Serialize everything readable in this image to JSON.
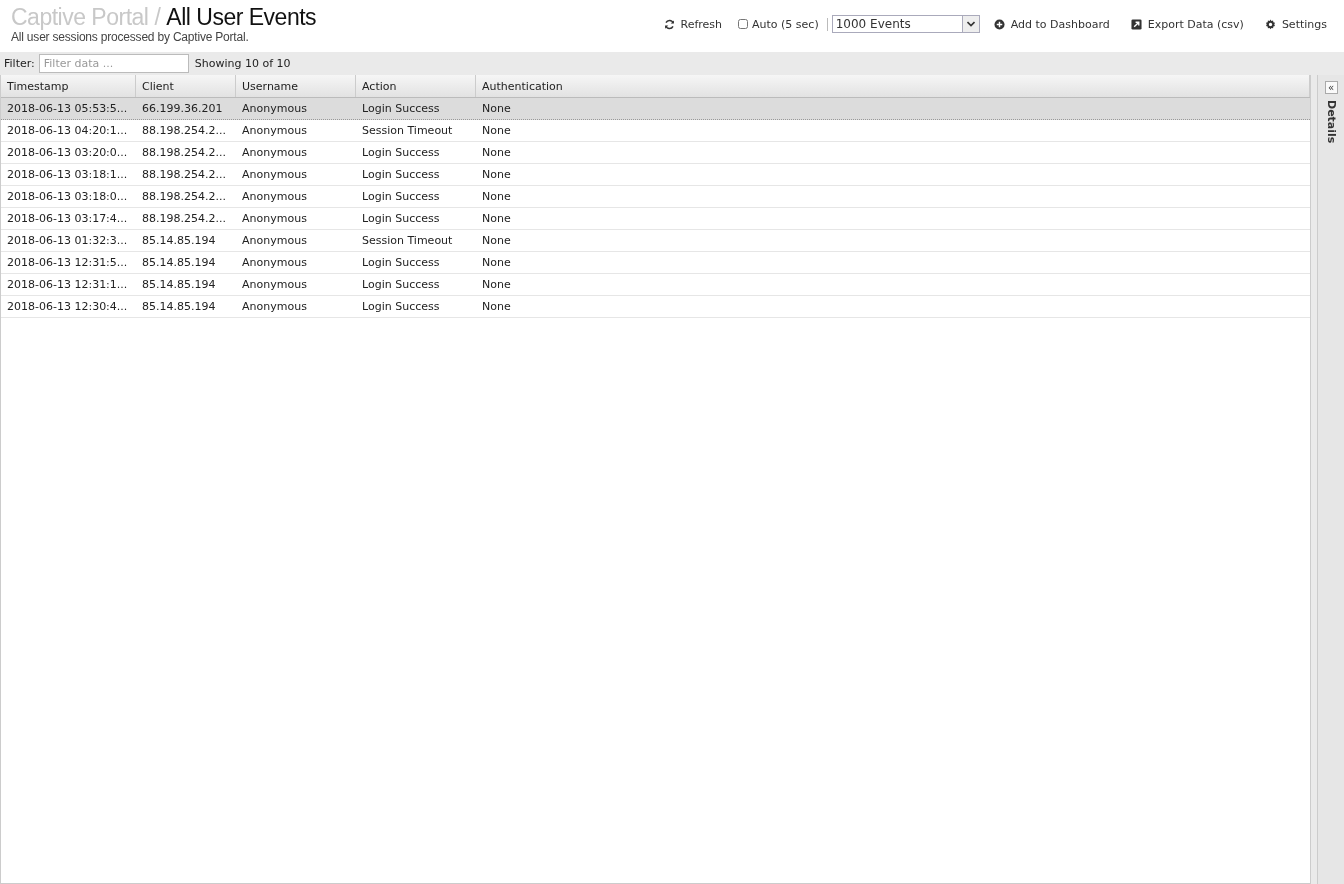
{
  "header": {
    "breadcrumb": "Captive Portal",
    "separator": "/",
    "title": "All User Events",
    "subtitle": "All user sessions processed by Captive Portal."
  },
  "toolbar": [
    {
      "kind": "button",
      "label": "Refresh"
    },
    {
      "kind": "checkbox",
      "label": "Auto (5 sec)",
      "checked": false
    },
    {
      "kind": "select",
      "value": "1000 Events"
    },
    {
      "kind": "button",
      "label": "Add to Dashboard"
    },
    {
      "kind": "button",
      "label": "Export Data (csv)"
    },
    {
      "kind": "button",
      "label": "Settings"
    }
  ],
  "filter": {
    "label": "Filter:",
    "placeholder": "Filter data ...",
    "count": "Showing 10 of 10"
  },
  "table": {
    "columns": [
      "Timestamp",
      "Client",
      "Username",
      "Action",
      "Authentication"
    ],
    "rows": [
      {
        "selected": true,
        "cells": [
          "2018-06-13 05:53:5...",
          "66.199.36.201",
          "Anonymous",
          "Login Success",
          "None"
        ]
      },
      {
        "selected": false,
        "cells": [
          "2018-06-13 04:20:1...",
          "88.198.254.2...",
          "Anonymous",
          "Session Timeout",
          "None"
        ]
      },
      {
        "selected": false,
        "cells": [
          "2018-06-13 03:20:0...",
          "88.198.254.2...",
          "Anonymous",
          "Login Success",
          "None"
        ]
      },
      {
        "selected": false,
        "cells": [
          "2018-06-13 03:18:1...",
          "88.198.254.2...",
          "Anonymous",
          "Login Success",
          "None"
        ]
      },
      {
        "selected": false,
        "cells": [
          "2018-06-13 03:18:0...",
          "88.198.254.2...",
          "Anonymous",
          "Login Success",
          "None"
        ]
      },
      {
        "selected": false,
        "cells": [
          "2018-06-13 03:17:4...",
          "88.198.254.2...",
          "Anonymous",
          "Login Success",
          "None"
        ]
      },
      {
        "selected": false,
        "cells": [
          "2018-06-13 01:32:3...",
          "85.14.85.194",
          "Anonymous",
          "Session Timeout",
          "None"
        ]
      },
      {
        "selected": false,
        "cells": [
          "2018-06-13 12:31:5...",
          "85.14.85.194",
          "Anonymous",
          "Login Success",
          "None"
        ]
      },
      {
        "selected": false,
        "cells": [
          "2018-06-13 12:31:1...",
          "85.14.85.194",
          "Anonymous",
          "Login Success",
          "None"
        ]
      },
      {
        "selected": false,
        "cells": [
          "2018-06-13 12:30:4...",
          "85.14.85.194",
          "Anonymous",
          "Login Success",
          "None"
        ]
      }
    ]
  },
  "details_panel": {
    "label": "Details",
    "collapse_icon": "«"
  }
}
